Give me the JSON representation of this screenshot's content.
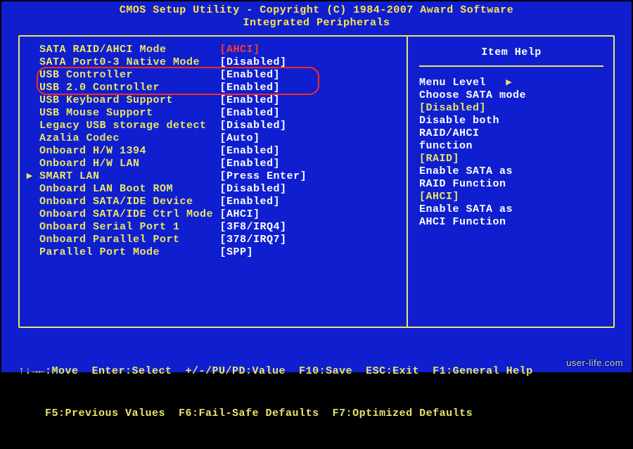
{
  "title_line1": "CMOS Setup Utility - Copyright (C) 1984-2007 Award Software",
  "title_line2": "Integrated Peripherals",
  "settings": [
    {
      "label": "SATA RAID/AHCI Mode",
      "value": "AHCI",
      "selected": true,
      "submenu": false
    },
    {
      "label": "SATA Port0-3 Native Mode",
      "value": "Disabled",
      "selected": false,
      "submenu": false
    },
    {
      "label": "USB Controller",
      "value": "Enabled",
      "selected": false,
      "submenu": false
    },
    {
      "label": "USB 2.0 Controller",
      "value": "Enabled",
      "selected": false,
      "submenu": false
    },
    {
      "label": "USB Keyboard Support",
      "value": "Enabled",
      "selected": false,
      "submenu": false
    },
    {
      "label": "USB Mouse Support",
      "value": "Enabled",
      "selected": false,
      "submenu": false
    },
    {
      "label": "Legacy USB storage detect",
      "value": "Disabled",
      "selected": false,
      "submenu": false
    },
    {
      "label": "Azalia Codec",
      "value": "Auto",
      "selected": false,
      "submenu": false
    },
    {
      "label": "Onboard H/W 1394",
      "value": "Enabled",
      "selected": false,
      "submenu": false
    },
    {
      "label": "Onboard H/W LAN",
      "value": "Enabled",
      "selected": false,
      "submenu": false
    },
    {
      "label": "SMART LAN",
      "value": "Press Enter",
      "selected": false,
      "submenu": true
    },
    {
      "label": "Onboard LAN Boot ROM",
      "value": "Disabled",
      "selected": false,
      "submenu": false
    },
    {
      "label": "Onboard SATA/IDE Device",
      "value": "Enabled",
      "selected": false,
      "submenu": false
    },
    {
      "label": "Onboard SATA/IDE Ctrl Mode",
      "value": "AHCI",
      "selected": false,
      "submenu": false
    },
    {
      "label": "Onboard Serial Port 1",
      "value": "3F8/IRQ4",
      "selected": false,
      "submenu": false
    },
    {
      "label": "Onboard Parallel Port",
      "value": "378/IRQ7",
      "selected": false,
      "submenu": false
    },
    {
      "label": "Parallel Port Mode",
      "value": "SPP",
      "selected": false,
      "submenu": false
    }
  ],
  "help": {
    "title": "Item Help",
    "menu_level_label": "Menu Level",
    "menu_level_arrow": "▸",
    "subtitle": "Choose SATA mode",
    "sections": [
      {
        "heading": "[Disabled]",
        "lines": [
          "Disable both",
          "RAID/AHCI",
          "function"
        ]
      },
      {
        "heading": "[RAID]",
        "lines": [
          "Enable SATA as",
          "RAID Function"
        ]
      },
      {
        "heading": "[AHCI]",
        "lines": [
          "Enable SATA as",
          "AHCI Function"
        ]
      }
    ]
  },
  "footer": {
    "line1": "↑↓→←:Move  Enter:Select  +/-/PU/PD:Value  F10:Save  ESC:Exit  F1:General Help",
    "line2": "    F5:Previous Values  F6:Fail-Safe Defaults  F7:Optimized Defaults"
  },
  "watermark": "user-life.com"
}
